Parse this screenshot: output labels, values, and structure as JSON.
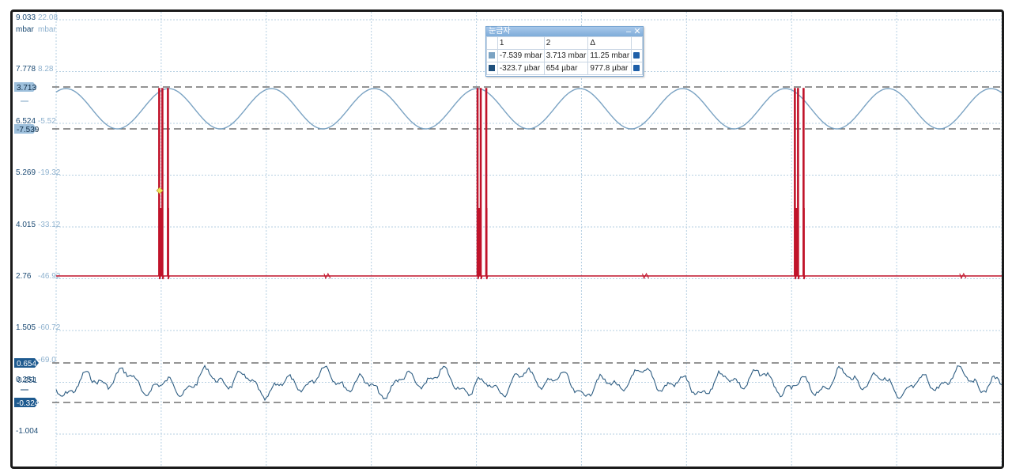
{
  "chart_data": {
    "type": "line",
    "x_grid_divisions": 9,
    "grid": true,
    "axes": {
      "left_units": "mbar",
      "right_units": "mbar",
      "left_ticks": [
        "9.033",
        "7.778",
        "6.524",
        "5.269",
        "4.015",
        "2.76",
        "1.505",
        "0.251",
        "-1.004"
      ],
      "right_ticks": [
        "22.08",
        "8.28",
        "-5.52",
        "-19.32",
        "-33.12",
        "-46.92",
        "-60.72",
        "-69.0"
      ]
    },
    "series": [
      {
        "color": "#7ba3c3",
        "cursor_high": "3.713",
        "cursor_low": "-7.539",
        "cycles": 9.2,
        "amplitude_mbar": 11.25
      },
      {
        "color": "#c0132a",
        "baseline_mbar": 2.76,
        "burst_divisions": [
          1.0,
          4.03,
          7.05
        ],
        "small_blip_divisions": [
          2.55,
          5.58,
          8.6
        ]
      },
      {
        "color": "#2e5d82",
        "cursor_high": "0.654",
        "cursor_low": "-0.324",
        "center_label": "0.251"
      }
    ],
    "marker": {
      "color": "#f3e35a"
    }
  },
  "cursor_panel": {
    "title": "눈금자",
    "col1": "1",
    "col2": "2",
    "col_delta": "Δ",
    "rows": [
      {
        "swatch": "#7ba3c3",
        "v1": "-7.539 mbar",
        "v2": "3.713 mbar",
        "delta": "11.25 mbar"
      },
      {
        "swatch": "#1e4f7c",
        "v1": "-323.7 µbar",
        "v2": "654 µbar",
        "delta": "977.8 µbar"
      }
    ],
    "min_icon": "minimize-icon",
    "close_icon": "close-icon"
  }
}
